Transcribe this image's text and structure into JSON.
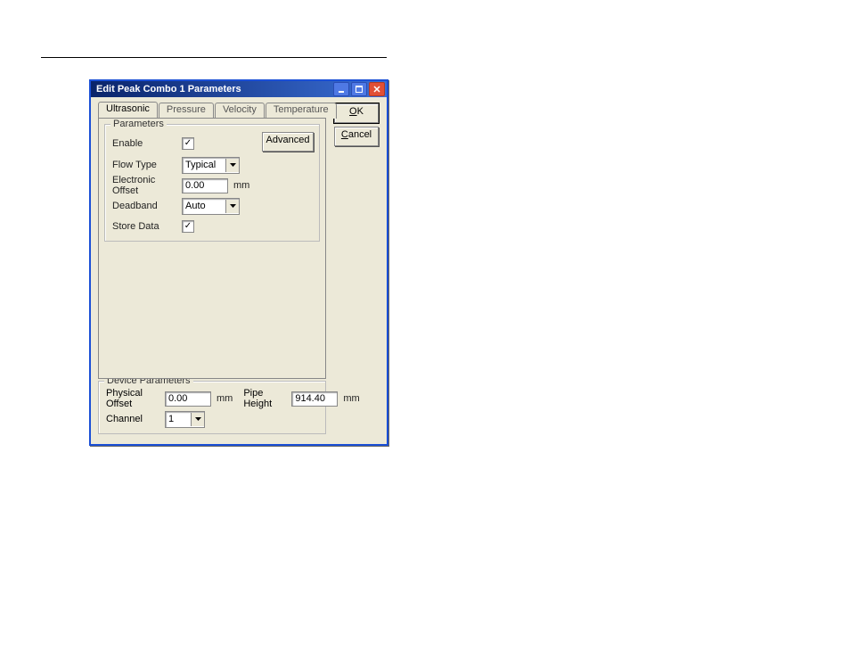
{
  "window": {
    "title": "Edit Peak Combo 1 Parameters"
  },
  "buttons": {
    "ok_u": "O",
    "ok_rest": "K",
    "cancel_u": "C",
    "cancel_rest": "ancel",
    "advanced": "Advanced"
  },
  "tabs": {
    "ultrasonic": "Ultrasonic",
    "pressure": "Pressure",
    "velocity": "Velocity",
    "temperature": "Temperature"
  },
  "fieldsets": {
    "parameters": "Parameters",
    "device_parameters": "Device Parameters"
  },
  "parameters": {
    "enable": {
      "label": "Enable",
      "checked": "✓"
    },
    "flow_type": {
      "label": "Flow Type",
      "value": "Typical"
    },
    "electronic_offset": {
      "label": "Electronic Offset",
      "value": "0.00",
      "unit": "mm"
    },
    "deadband": {
      "label": "Deadband",
      "value": "Auto"
    },
    "store_data": {
      "label": "Store Data",
      "checked": "✓"
    }
  },
  "device": {
    "physical_offset": {
      "label": "Physical Offset",
      "value": "0.00",
      "unit": "mm"
    },
    "pipe_height": {
      "label": "Pipe Height",
      "value": "914.40",
      "unit": "mm"
    },
    "channel": {
      "label": "Channel",
      "value": "1"
    }
  }
}
